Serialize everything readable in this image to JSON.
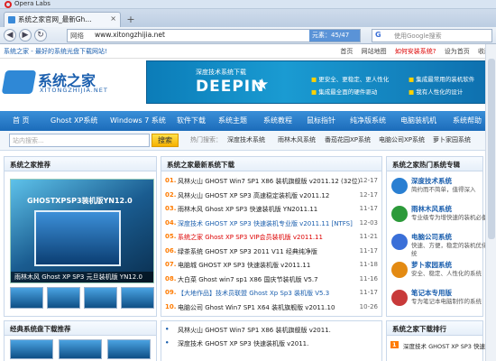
{
  "browser": {
    "title": "Opera Labs",
    "tab_title": "系统之家官网_最新Gh...",
    "tab_close": "×",
    "new_tab": "+",
    "net_label": "网络",
    "url": "www.xitongzhijia.net",
    "progress": "元素：45/47",
    "search_engine": "G",
    "search_placeholder": "使用Google搜索",
    "back": "◀",
    "forward": "▶",
    "reload": "↻"
  },
  "site": {
    "top_left": "系统之家 - 最好的系统光盘下载网站!",
    "top_links": [
      "首页",
      "网站地图",
      "如何安装系统?",
      "设为首页",
      "收藏"
    ],
    "logo_name": "系统之家",
    "logo_en": "XITONGZHIJIA.NET",
    "banner": {
      "small": "深度技术系统下载",
      "brand": "DEEPIN",
      "star": "★",
      "features": [
        "更安全、更稳定、更人性化",
        "集成最常用的装机软件",
        "集成最全面的硬件驱动",
        "我有人性化的设计"
      ]
    },
    "nav": [
      "首 页",
      "Ghost XP系统",
      "Windows 7 系统",
      "软件下载",
      "系统主题",
      "系统教程",
      "鼠标指针",
      "纯净版系统",
      "电脑装机机",
      "系统帮助"
    ],
    "search": {
      "placeholder": "站内搜索...",
      "button": "搜索",
      "hot_label": "热门搜索：",
      "hot": [
        "深度技术系统",
        "雨林木风系统",
        "番茄花园XP系统",
        "电脑公司XP系统",
        "萝卜家园系统"
      ]
    },
    "left_panel": {
      "title": "系统之家推荐",
      "feature_title": "GHOSTXPSP3装机版YN12.0",
      "caption": "雨林木风  Ghost XP SP3 元旦装机版 YN12.0"
    },
    "center_panel": {
      "title": "系统之家最新系统下载",
      "items": [
        {
          "n": "01.",
          "t": "风林火山 GHOST Win7 SP1 X86 装机旗舰版 v2011.12 (32位)",
          "d": "12-17",
          "style": ""
        },
        {
          "n": "02.",
          "t": "风林火山 GHOST XP SP3 高速稳定装机版 v2011.12",
          "d": "12-17",
          "style": ""
        },
        {
          "n": "03.",
          "t": "雨林木风 Ghost XP SP3 快速装机版 YN2011.11",
          "d": "11-17",
          "style": ""
        },
        {
          "n": "04.",
          "t": "深度技术 GHOST XP SP3 快速装机专业版 v2011.11 [NTFS]",
          "d": "12-03",
          "style": "blue"
        },
        {
          "n": "05.",
          "t": "系统之家 Ghost XP SP3 VIP会员装机版 v2011.11",
          "d": "11-21",
          "style": "red"
        },
        {
          "n": "06.",
          "t": "绿茶系统 GHOST XP SP3 2011 V11 经典纯净版",
          "d": "11-17",
          "style": ""
        },
        {
          "n": "07.",
          "t": "电脑城 GHOST XP SP3 快速装机版 v2011.11",
          "d": "11-18",
          "style": ""
        },
        {
          "n": "08.",
          "t": "大白菜 Ghost win7 sp1 X86 国庆节装机版 V5.7",
          "d": "11-16",
          "style": ""
        },
        {
          "n": "09.",
          "t": "【大地作品】技术员联盟 Ghost Xp Sp3 装机版 V5.3",
          "d": "11-17",
          "style": "blue"
        },
        {
          "n": "10.",
          "t": "电脑公司 Ghost Win7 SP1 X64 装机旗舰版 v2011.10",
          "d": "10-26",
          "style": ""
        }
      ]
    },
    "right_panel": {
      "title": "系统之家热门系统专辑",
      "items": [
        {
          "h": "深度技术系统",
          "d": "简约而不简单，值得深入",
          "color": "#2a7fd2"
        },
        {
          "h": "雨林木风系统",
          "d": "专业级专为增快速的装机必备",
          "color": "#2c9a3a"
        },
        {
          "h": "电脑公司系统",
          "d": "快速、方便，稳定的装机优化系统",
          "color": "#3a6fd8"
        },
        {
          "h": "萝卜家园系统",
          "d": "安全、稳定、人性化的系统",
          "color": "#e38a12"
        },
        {
          "h": "笔记本专用版",
          "d": "专为笔记本电脑制作的系统",
          "color": "#c83a3a"
        }
      ]
    },
    "bottom": {
      "left_title": "经典系统盘下载推荐",
      "center_item": "风林火山 GHOST Win7 SP1 X86 装机旗舰版 v2011.",
      "center_item2": "深度技术 GHOST XP SP3 快速装机版 v2011.",
      "right_title": "系统之家下载排行",
      "right_item": "深度技术 GHOST XP SP3 快速装"
    }
  }
}
